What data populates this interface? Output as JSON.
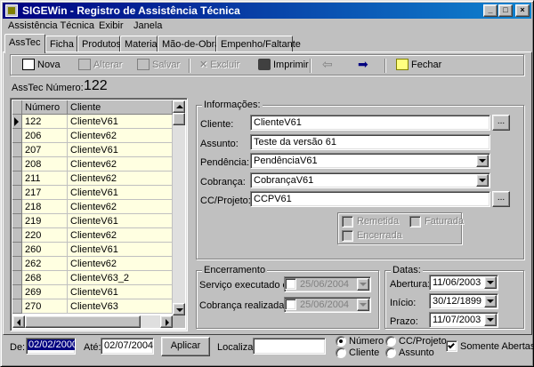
{
  "window": {
    "title": "SIGEWin - Registro de Assistência Técnica"
  },
  "menu": [
    "Assistência Técnica",
    "Exibir",
    "Janela"
  ],
  "tabs": [
    "AssTec",
    "Ficha",
    "Produtos",
    "Material",
    "Mão-de-Obra",
    "Empenho/Faltante"
  ],
  "toolbar": {
    "nova": "Nova",
    "alterar": "Alterar",
    "salvar": "Salvar",
    "excluir": "Excluir",
    "imprimir": "Imprimir",
    "fechar": "Fechar"
  },
  "record": {
    "label": "AssTec Número:",
    "number": "122"
  },
  "grid": {
    "columns": [
      "Número",
      "Cliente"
    ],
    "rows": [
      [
        "122",
        "ClienteV61"
      ],
      [
        "206",
        "Clientev62"
      ],
      [
        "207",
        "ClienteV61"
      ],
      [
        "208",
        "Clientev62"
      ],
      [
        "211",
        "Clientev62"
      ],
      [
        "217",
        "ClienteV61"
      ],
      [
        "218",
        "Clientev62"
      ],
      [
        "219",
        "ClienteV61"
      ],
      [
        "220",
        "Clientev62"
      ],
      [
        "260",
        "ClienteV61"
      ],
      [
        "262",
        "Clientev62"
      ],
      [
        "268",
        "ClienteV63_2"
      ],
      [
        "269",
        "ClienteV61"
      ],
      [
        "270",
        "ClienteV63"
      ]
    ]
  },
  "info": {
    "title": "Informações:",
    "cliente_label": "Cliente:",
    "cliente": "ClienteV61",
    "assunto_label": "Assunto:",
    "assunto": "Teste da versão 61",
    "pendencia_label": "Pendência:",
    "pendencia": "PendênciaV61",
    "cobranca_label": "Cobrança:",
    "cobranca": "CobrançaV61",
    "ccprojeto_label": "CC/Projeto:",
    "ccprojeto": "CCPV61",
    "ellipsis": "...",
    "remetida": "Remetida",
    "faturada": "Faturada",
    "encerrada": "Encerrada"
  },
  "encerramento": {
    "title": "Encerramento",
    "servico_label": "Serviço executado em",
    "servico_date": "25/06/2004",
    "cobranca_label": "Cobrança realizada em",
    "cobranca_date": "25/06/2004"
  },
  "datas": {
    "title": "Datas:",
    "abertura_label": "Abertura:",
    "abertura": "11/06/2003",
    "inicio_label": "Início:",
    "inicio": "30/12/1899",
    "prazo_label": "Prazo:",
    "prazo": "11/07/2003"
  },
  "filter": {
    "de_label": "De:",
    "de": "02/02/2000",
    "ate_label": "Até:",
    "ate": "02/07/2004",
    "aplicar": "Aplicar",
    "localizar_label": "Localizar:",
    "localizar": "",
    "numero": "Número",
    "cliente": "Cliente",
    "ccprojeto": "CC/Projeto",
    "assunto": "Assunto",
    "somente_abertas": "Somente Abertas"
  }
}
